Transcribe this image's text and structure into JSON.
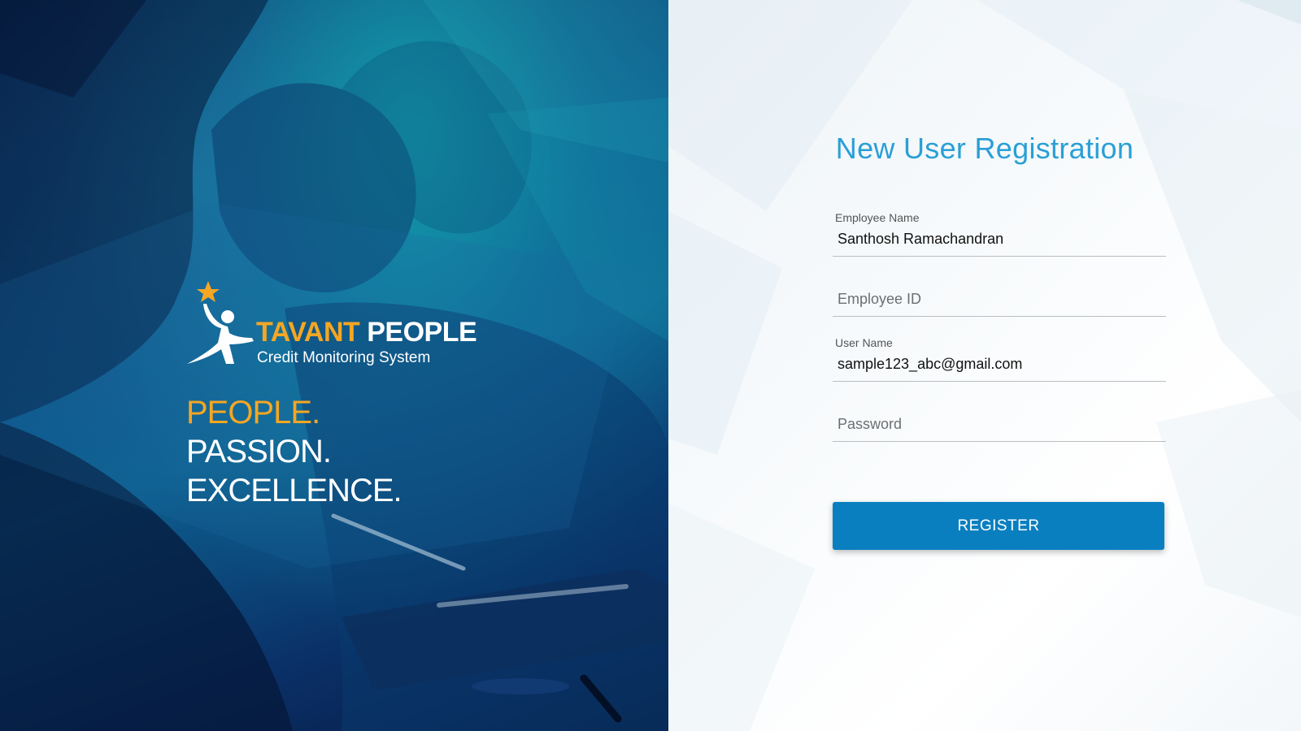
{
  "colors": {
    "accent_orange": "#f5a623",
    "title_blue": "#2a9fd6",
    "button_blue": "#0a7fc0",
    "left_panel_dark": "#0a2a5a"
  },
  "brand": {
    "name_part1": "TAVANT",
    "name_part2": " PEOPLE",
    "subtitle": "Credit Monitoring System",
    "logo_icon": "star-figure-icon"
  },
  "tagline": {
    "line1": "PEOPLE.",
    "line2": "PASSION.",
    "line3": "EXCELLENCE."
  },
  "form": {
    "title": "New User Registration",
    "fields": {
      "employee_name": {
        "label": "Employee Name",
        "value": "Santhosh Ramachandran"
      },
      "employee_id": {
        "placeholder": "Employee ID",
        "value": ""
      },
      "user_name": {
        "label": "User Name",
        "value": "sample123_abc@gmail.com"
      },
      "password": {
        "placeholder": "Password",
        "value": ""
      }
    },
    "submit_label": "REGISTER"
  }
}
